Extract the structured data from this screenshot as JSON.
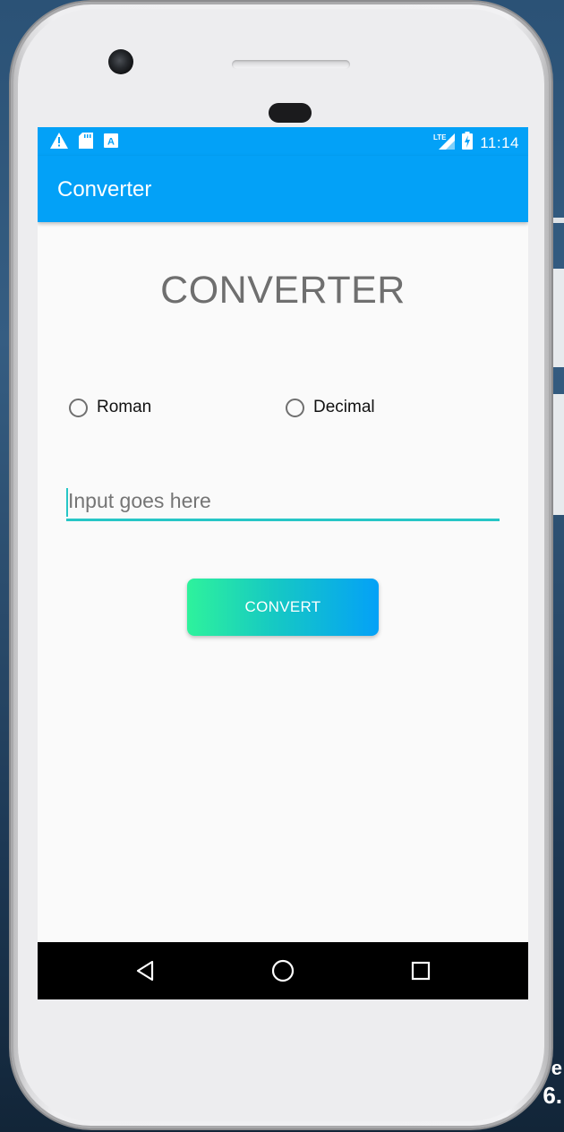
{
  "status_bar": {
    "time": "11:14",
    "network_label": "LTE",
    "icons": [
      "warning-icon",
      "sd-card-icon",
      "keyboard-a-icon",
      "signal-icon",
      "battery-icon"
    ]
  },
  "app_bar": {
    "title": "Converter",
    "background_color": "#03a1f7"
  },
  "main": {
    "heading": "CONVERTER",
    "radio_options": [
      {
        "label": "Roman",
        "selected": false
      },
      {
        "label": "Decimal",
        "selected": false
      }
    ],
    "input": {
      "value": "",
      "placeholder": "Input goes here",
      "underline_color": "#26c6c6"
    },
    "convert_button": {
      "label": "CONVERT",
      "gradient_start": "#2ef29c",
      "gradient_end": "#04a1f7"
    }
  },
  "nav_bar": {
    "icons": [
      "back-icon",
      "home-icon",
      "recents-icon"
    ]
  }
}
